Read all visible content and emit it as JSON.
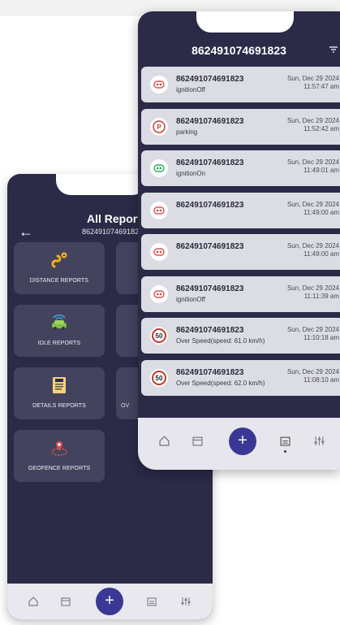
{
  "back": {
    "title": "All Reports",
    "subtitle": "86249107469182",
    "tiles": [
      {
        "label": "DISTANCE REPORTS",
        "icon": "route-pin-icon"
      },
      {
        "label": "IDLE REPORTS",
        "icon": "car-signal-icon"
      },
      {
        "label": "DETAILS REPORTS",
        "icon": "info-document-icon"
      },
      {
        "label": "GEOFENCE REPORTS",
        "icon": "geofence-pin-icon"
      }
    ],
    "ghost_label": "OV",
    "fab_label": "+"
  },
  "front": {
    "title": "862491074691823",
    "fab_label": "+",
    "events": [
      {
        "device": "862491074691823",
        "status": "ignitionOff",
        "date": "Sun, Dec 29 2024",
        "time": "11:57:47 am",
        "icon": "ignition-off-icon",
        "color": "#d9534f"
      },
      {
        "device": "862491074691823",
        "status": "parking",
        "date": "Sun, Dec 29 2024",
        "time": "11:52:42 am",
        "icon": "parking-icon",
        "color": "#c0392b"
      },
      {
        "device": "862491074691823",
        "status": "ignitionOn",
        "date": "Sun, Dec 29 2024",
        "time": "11:49:01 am",
        "icon": "ignition-on-icon",
        "color": "#27ae60"
      },
      {
        "device": "862491074691823",
        "status": "",
        "date": "Sun, Dec 29 2024",
        "time": "11:49:00 am",
        "icon": "ignition-off-icon",
        "color": "#d9534f"
      },
      {
        "device": "862491074691823",
        "status": "",
        "date": "Sun, Dec 29 2024",
        "time": "11:49:00 am",
        "icon": "ignition-off-icon",
        "color": "#d9534f"
      },
      {
        "device": "862491074691823",
        "status": "ignitionOff",
        "date": "Sun, Dec 29 2024",
        "time": "11:11:39 am",
        "icon": "ignition-off-icon",
        "color": "#d9534f"
      },
      {
        "device": "862491074691823",
        "status": "Over Speed(speed: 61.0 km/h)",
        "date": "Sun, Dec 29 2024",
        "time": "11:10:18 am",
        "icon": "speed-limit-50-icon",
        "color": "#c0392b"
      },
      {
        "device": "862491074691823",
        "status": "Over Speed(speed: 62.0 km/h)",
        "date": "Sun, Dec 29 2024",
        "time": "11:08:10 am",
        "icon": "speed-limit-50-icon",
        "color": "#c0392b"
      }
    ]
  }
}
